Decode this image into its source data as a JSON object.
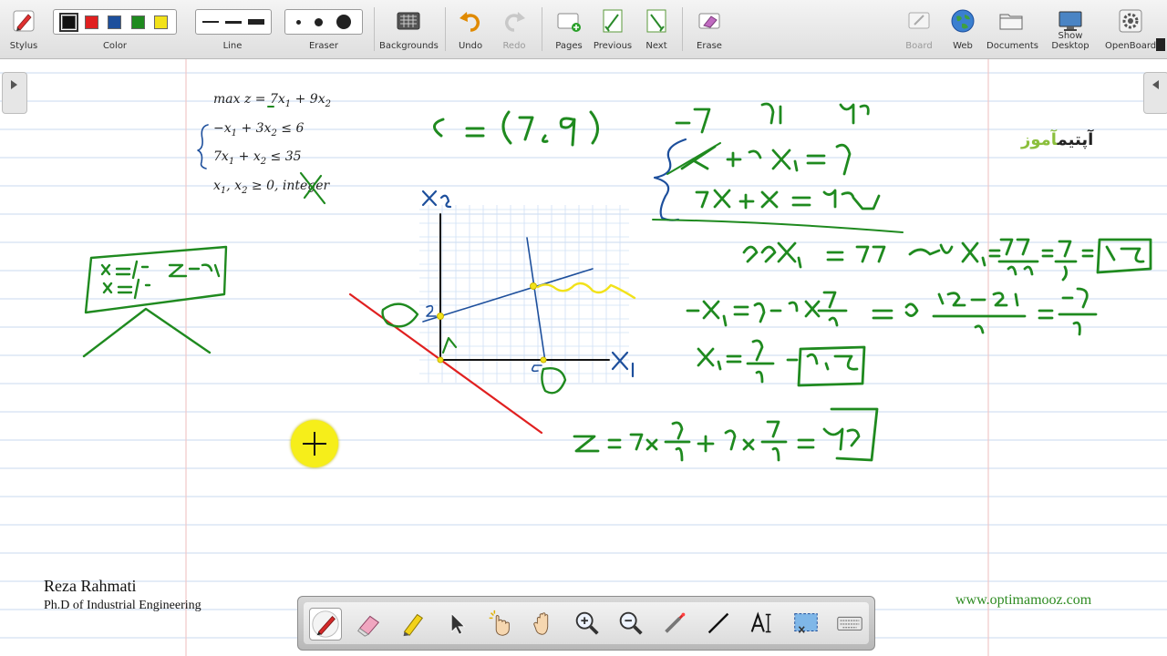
{
  "toolbar": {
    "stylus": "Stylus",
    "color": "Color",
    "line": "Line",
    "eraser": "Eraser",
    "backgrounds": "Backgrounds",
    "undo": "Undo",
    "redo": "Redo",
    "pages": "Pages",
    "previous": "Previous",
    "next": "Next",
    "erase": "Erase",
    "board": "Board",
    "web": "Web",
    "documents": "Documents",
    "show_desktop": "Show Desktop",
    "openboard": "OpenBoard",
    "colors": [
      "#111111",
      "#e02020",
      "#1d4f9c",
      "#1f8a1f",
      "#f2e21a"
    ],
    "selected_color": "#111111"
  },
  "board": {
    "problem": {
      "objective_prefix": "max z = ",
      "objective_terms": "7x",
      "objective_tail": " + 9x",
      "c1_a": "−x",
      "c1_b": " + 3x",
      "c1_rhs": " ≤ 6",
      "c2_a": "7x",
      "c2_b": " + x",
      "c2_rhs": " ≤ 35",
      "nonneg_a": "x",
      "nonneg_b": ", x",
      "nonneg_rhs": " ≥ 0, integer",
      "sub1": "1",
      "sub2": "2"
    },
    "author_name": "Reza Rahmati",
    "author_title": "Ph.D of Industrial Engineering",
    "website": "www.optimamooz.com",
    "logo_dark": "آپتیم",
    "logo_green": "آموز"
  },
  "palette": {
    "tools": [
      "pen-tool",
      "eraser-tool",
      "marker-tool",
      "selector-tool",
      "interact-tool",
      "hand-tool",
      "zoom-in-tool",
      "zoom-out-tool",
      "laser-tool",
      "line-tool",
      "text-tool",
      "capture-tool",
      "keyboard-tool"
    ]
  },
  "colors": {
    "ink_green": "#1f8a1f",
    "ink_blue": "#1d4f9c",
    "ink_red": "#e02020",
    "ink_yellow": "#f2e21a",
    "grid_line": "#c9d8ef",
    "margin_line": "#f0c9c9"
  }
}
